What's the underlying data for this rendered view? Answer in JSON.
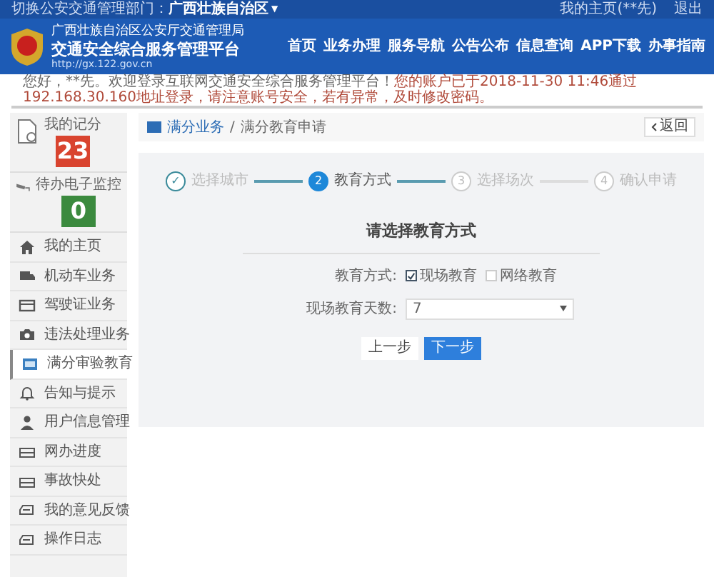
{
  "top_bar": {
    "switch_label": "切换公安交通管理部门：",
    "region": "广西壮族自治区",
    "region_caret": "▼",
    "user_link": "我的主页(**先)",
    "logout": "退出"
  },
  "header": {
    "subtitle": "广西壮族自治区公安厅交通管理局",
    "title": "交通安全综合服务管理平台",
    "url": "http://gx.122.gov.cn",
    "nav": [
      "首页",
      "业务办理",
      "服务导航",
      "公告公布",
      "信息查询",
      "APP下载",
      "办事指南"
    ]
  },
  "welcome": {
    "greeting": "您好，**先。欢迎登录互联网交通安全综合服务管理平台！",
    "login_notice": "您的账户已于2018-11-30 11:46通过192.168.30.160地址登录，请注意账号安全，若有异常，及时修改密码。"
  },
  "sidebar": {
    "cards": [
      {
        "kind": "score",
        "label": "我的记分",
        "value": "23",
        "color": "#d9442f"
      },
      {
        "kind": "camera",
        "label": "待办电子监控",
        "value": "0",
        "color": "#3b8a3e"
      }
    ],
    "items": [
      {
        "label": "我的主页",
        "selected": false
      },
      {
        "label": "机动车业务",
        "selected": false
      },
      {
        "label": "驾驶证业务",
        "selected": false
      },
      {
        "label": "违法处理业务",
        "selected": false
      },
      {
        "label": "满分审验教育",
        "selected": true
      },
      {
        "label": "告知与提示",
        "selected": false
      },
      {
        "label": "用户信息管理",
        "selected": false
      },
      {
        "label": "网办进度",
        "selected": false
      },
      {
        "label": "事故快处",
        "selected": false
      },
      {
        "label": "我的意见反馈",
        "selected": false
      },
      {
        "label": "操作日志",
        "selected": false
      }
    ]
  },
  "breadcrumb": {
    "section": "满分业务",
    "separator": "/",
    "page": "满分教育申请",
    "back": "返回"
  },
  "steps": [
    {
      "marker": "✓",
      "label": "选择城市",
      "done": true,
      "selected": false
    },
    {
      "marker": "2",
      "label": "教育方式",
      "done": false,
      "selected": true
    },
    {
      "marker": "3",
      "label": "选择场次",
      "done": false,
      "selected": false
    },
    {
      "marker": "4",
      "label": "确认申请",
      "done": false,
      "selected": false
    }
  ],
  "form": {
    "title": "请选择教育方式",
    "method_label": "教育方式:",
    "options": [
      {
        "label": "现场教育",
        "checked": true
      },
      {
        "label": "网络教育",
        "checked": false
      }
    ],
    "days_label": "现场教育天数:",
    "days_value": "7",
    "prev": "上一步",
    "next": "下一步"
  }
}
